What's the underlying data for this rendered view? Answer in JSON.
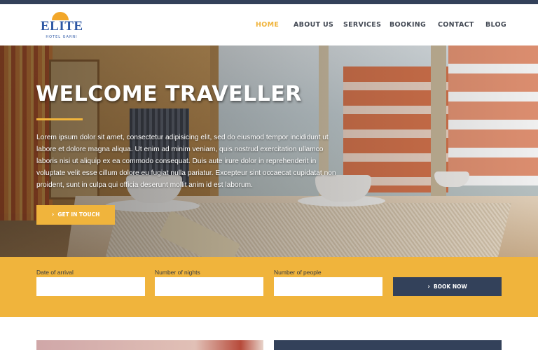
{
  "brand": {
    "logo_text": "ELITE",
    "logo_subtext": "HOTEL GARNI",
    "accent_color": "#f0b43c",
    "dark_color": "#33415a"
  },
  "nav": {
    "items": [
      {
        "label": "HOME",
        "active": true
      },
      {
        "label": "ABOUT US",
        "active": false
      },
      {
        "label": "SERVICES",
        "active": false
      },
      {
        "label": "BOOKING",
        "active": false
      },
      {
        "label": "CONTACT",
        "active": false
      },
      {
        "label": "BLOG",
        "active": false
      }
    ]
  },
  "hero": {
    "title": "WELCOME TRAVELLER",
    "body": "Lorem ipsum dolor sit amet, consectetur adipisicing elit, sed do eiusmod tempor incididunt ut labore et dolore magna aliqua. Ut enim ad minim veniam, quis nostrud exercitation ullamco laboris nisi ut aliquip ex ea commodo consequat. Duis aute irure dolor in reprehenderit in voluptate velit esse cillum dolore eu fugiat nulla pariatur. Excepteur sint occaecat cupidatat non proident, sunt in culpa qui officia deserunt mollit anim id est laborum.",
    "cta_label": "GET IN TOUCH",
    "cta_icon": "chevron-right-icon"
  },
  "booking": {
    "arrival_label": "Date of arrival",
    "arrival_value": "",
    "nights_label": "Number of nights",
    "nights_value": "",
    "people_label": "Number of people",
    "people_value": "",
    "button_label": "BOOK NOW",
    "button_icon": "chevron-right-icon"
  }
}
